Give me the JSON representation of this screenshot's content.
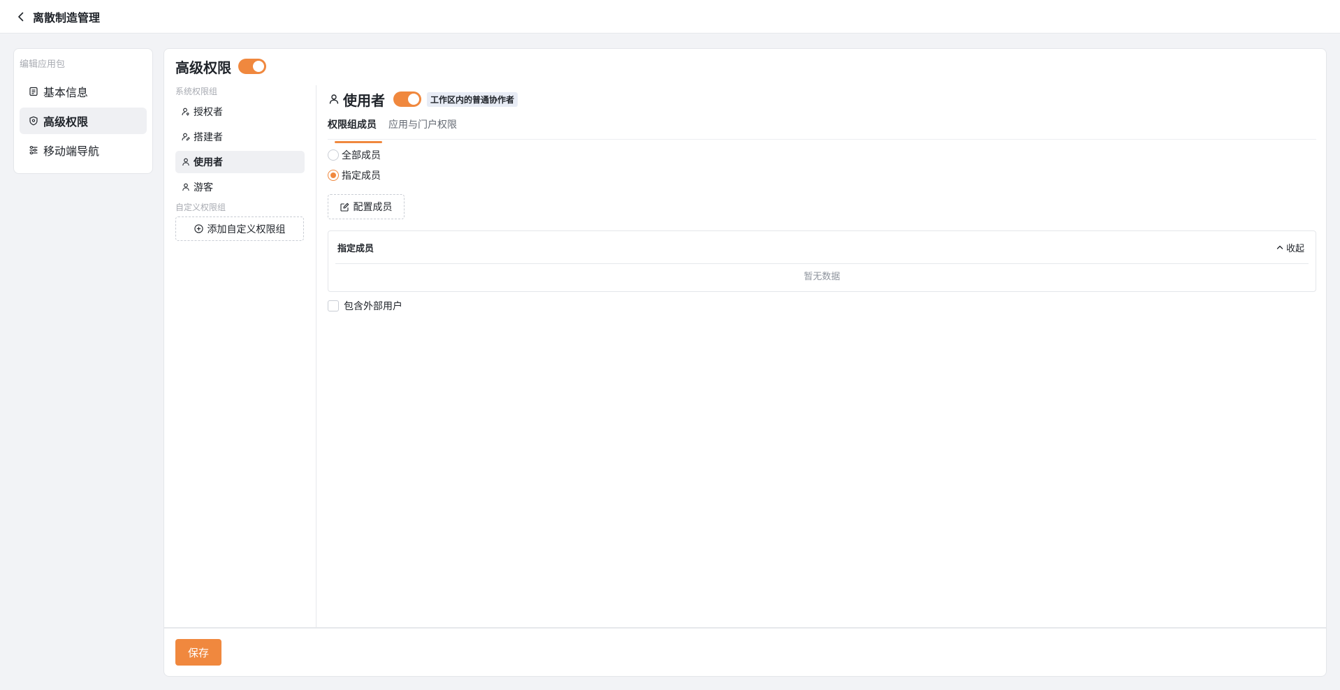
{
  "header": {
    "back_icon": "chevron-left-icon",
    "title": "离散制造管理"
  },
  "sidebar": {
    "heading": "编辑应用包",
    "items": [
      {
        "label": "基本信息",
        "icon": "document-icon",
        "active": false
      },
      {
        "label": "高级权限",
        "icon": "shield-icon",
        "active": true
      },
      {
        "label": "移动端导航",
        "icon": "sliders-icon",
        "active": false
      }
    ]
  },
  "main": {
    "title": "高级权限",
    "enabled": true,
    "groups": {
      "system_heading": "系统权限组",
      "system_items": [
        {
          "label": "授权者",
          "icon": "user-key-icon",
          "active": false
        },
        {
          "label": "搭建者",
          "icon": "user-edit-icon",
          "active": false
        },
        {
          "label": "使用者",
          "icon": "user-icon",
          "active": true
        },
        {
          "label": "游客",
          "icon": "user-icon",
          "active": false
        }
      ],
      "custom_heading": "自定义权限组",
      "add_button": "添加自定义权限组"
    },
    "role": {
      "title": "使用者",
      "enabled": true,
      "badge": "工作区内的普通协作者",
      "tabs": [
        {
          "label": "权限组成员",
          "active": true
        },
        {
          "label": "应用与门户权限",
          "active": false
        }
      ],
      "member_options": [
        {
          "label": "全部成员",
          "checked": false
        },
        {
          "label": "指定成员",
          "checked": true
        }
      ],
      "config_button": "配置成员",
      "members_panel": {
        "title": "指定成员",
        "collapse_label": "收起",
        "empty_text": "暂无数据"
      },
      "include_external_label": "包含外部用户",
      "include_external_checked": false
    }
  },
  "footer": {
    "save_label": "保存"
  },
  "colors": {
    "accent": "#f0883e",
    "background": "#f2f3f6",
    "active_item": "#eff0f3"
  }
}
